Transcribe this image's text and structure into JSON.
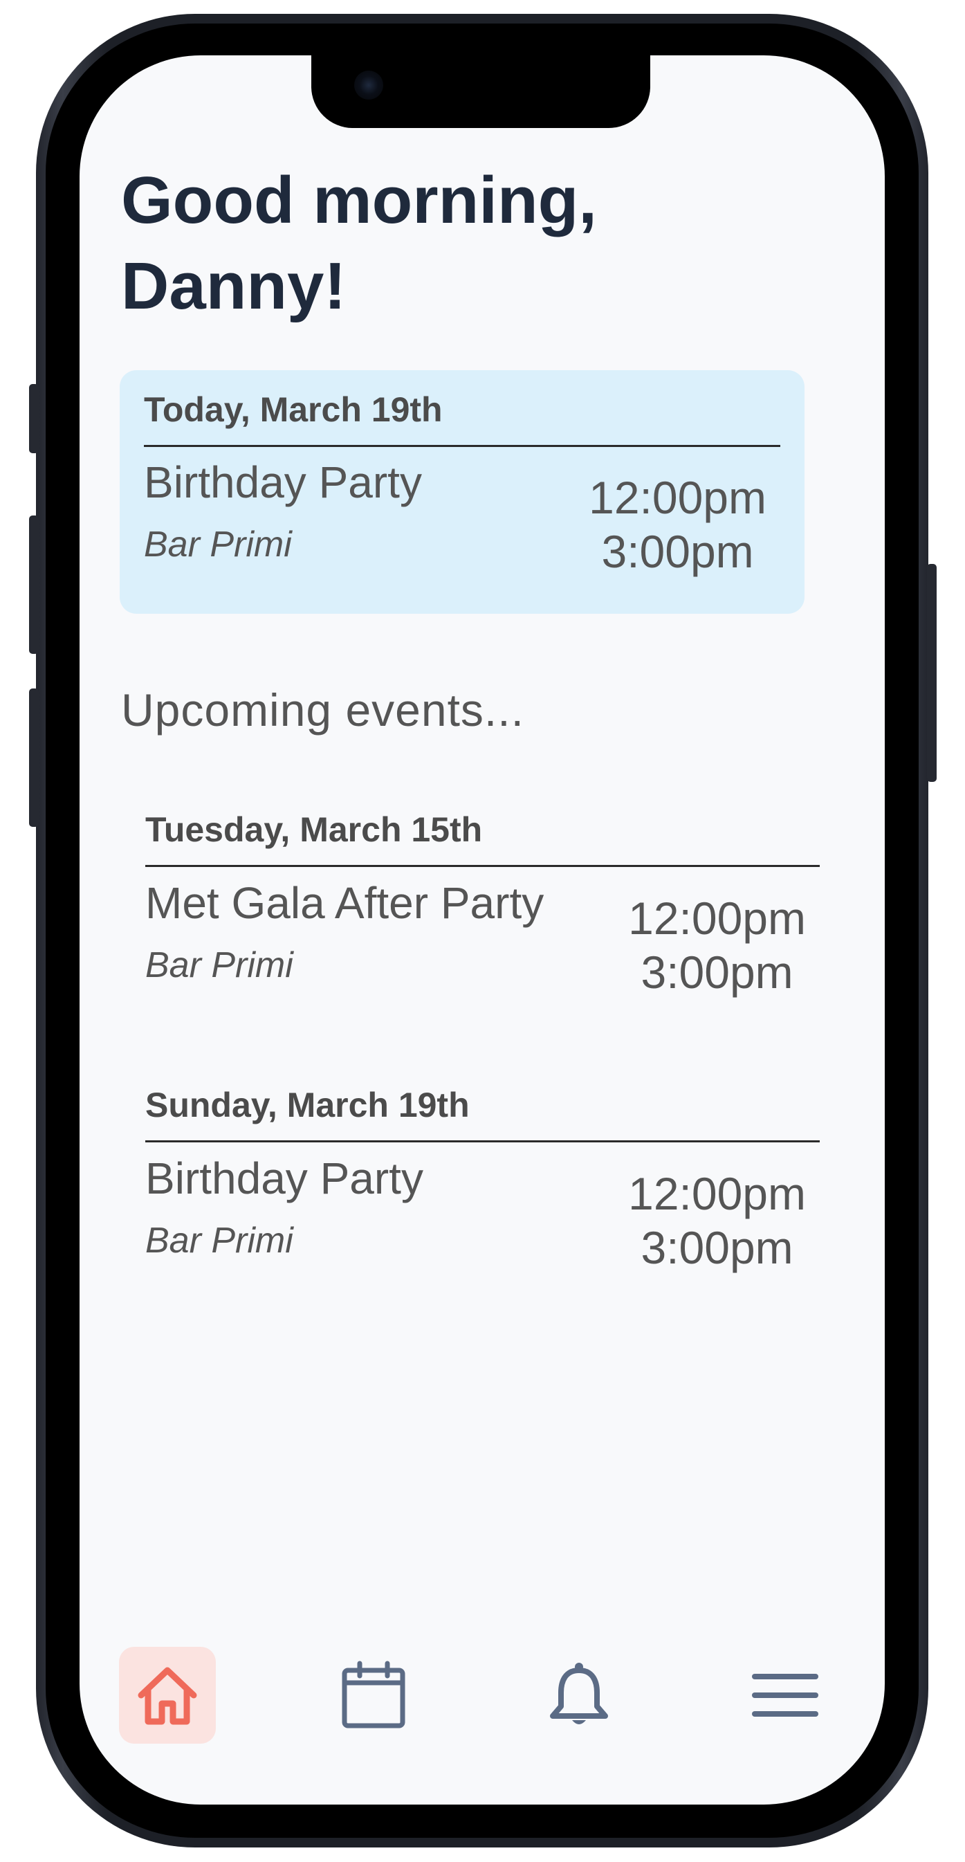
{
  "greeting": {
    "line1": "Good morning,",
    "line2": "Danny!"
  },
  "today": {
    "date": "Today, March 19th",
    "title": "Birthday Party",
    "location": "Bar Primi",
    "start_time": "12:00pm",
    "end_time": "3:00pm"
  },
  "upcoming": {
    "heading": "Upcoming events...",
    "events": [
      {
        "date": "Tuesday, March 15th",
        "title": "Met Gala After Party",
        "location": "Bar Primi",
        "start_time": "12:00pm",
        "end_time": "3:00pm"
      },
      {
        "date": "Sunday, March 19th",
        "title": "Birthday Party",
        "location": "Bar Primi",
        "start_time": "12:00pm",
        "end_time": "3:00pm"
      }
    ]
  },
  "nav": {
    "items": [
      {
        "icon": "home-icon",
        "active": true
      },
      {
        "icon": "calendar-icon",
        "active": false
      },
      {
        "icon": "bell-icon",
        "active": false
      },
      {
        "icon": "menu-icon",
        "active": false
      }
    ]
  },
  "colors": {
    "accent": "#ef6a5a",
    "accent_bg": "#fbe3e0",
    "nav_icon": "#5b6b85",
    "today_card_bg": "#dbf0fb",
    "heading_text": "#1f2a3c"
  }
}
